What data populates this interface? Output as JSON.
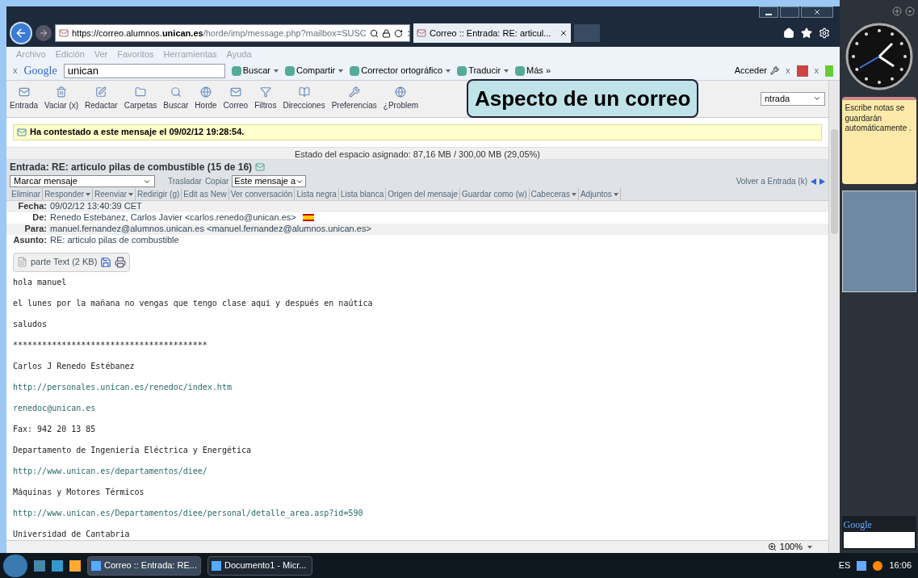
{
  "browser": {
    "address": {
      "prefix": "https://correo.alumnos.",
      "domain": "unican.es",
      "rest": "/horde/imp/message.php?mailbox=SUSC"
    },
    "tab": {
      "title": "Correo :: Entrada: RE: articul...",
      "selected": true
    },
    "menu": [
      "Archivo",
      "Edición",
      "Ver",
      "Favoritos",
      "Herramientas",
      "Ayuda"
    ],
    "google_toolbar": {
      "close": "x",
      "logo": "Google",
      "query": "unican",
      "items": [
        {
          "label": "Buscar",
          "menu": true
        },
        {
          "label": "Compartir",
          "menu": true
        },
        {
          "label": "Corrector ortográfico",
          "menu": true
        },
        {
          "label": "Traducir",
          "menu": true
        },
        {
          "label": "Más »",
          "menu": false
        }
      ],
      "signin": "Acceder",
      "close_right": "x",
      "close_far": "x"
    }
  },
  "horde_toolbar": [
    "Entrada",
    "Vaciar (x)",
    "Redactar",
    "Carpetas",
    "Buscar",
    "Horde",
    "Correo",
    "Filtros",
    "Direcciones",
    "Preferencias",
    "¿Problem"
  ],
  "folder_select": "ntrada",
  "callout": "Aspecto de un correo",
  "notice": "Ha contestado a este mensaje el 09/02/12 19:28:54.",
  "quota": "Estado del espacio asignado: 87,16 MB / 300,00 MB (29,05%)",
  "message_title": "Entrada: RE: articulo pilas de combustible (15 de 16)",
  "actions": {
    "mark_select": "Marcar mensaje",
    "move": "Trasladar",
    "copy": "Copiar",
    "target_select": "Este mensaje a",
    "back": "Volver a Entrada (k)"
  },
  "links": [
    {
      "label": "Eliminar",
      "menu": false
    },
    {
      "label": "Responder",
      "menu": true
    },
    {
      "label": "Reenviar",
      "menu": true
    },
    {
      "label": "Redirigir (g)",
      "menu": false
    },
    {
      "label": "Edit as New",
      "menu": false
    },
    {
      "label": "Ver conversación",
      "menu": false
    },
    {
      "label": "Lista negra",
      "menu": false
    },
    {
      "label": "Lista blanca",
      "menu": false
    },
    {
      "label": "Origen del mensaje",
      "menu": false
    },
    {
      "label": "Guardar como (w)",
      "menu": false
    },
    {
      "label": "Cabeceras",
      "menu": true
    },
    {
      "label": "Adjuntos",
      "menu": true
    }
  ],
  "headers": [
    {
      "label": "Fecha:",
      "value": "09/02/12 13:40:39 CET",
      "flag": false
    },
    {
      "label": "De:",
      "value": "Renedo Estebanez, Carlos Javier <carlos.renedo@unican.es>",
      "flag": true
    },
    {
      "label": "Para:",
      "value": "manuel.fernandez@alumnos.unican.es <manuel.fernandez@alumnos.unican.es>",
      "flag": false
    },
    {
      "label": "Asunto:",
      "value": "RE: articulo pilas de combustible",
      "flag": false
    }
  ],
  "part": "parte Text (2 KB)",
  "body": [
    {
      "kind": "text",
      "text": "hola manuel"
    },
    {
      "kind": "text",
      "text": "el lunes por la mañana no vengas que tengo clase aqui y después en naútica"
    },
    {
      "kind": "text",
      "text": "saludos"
    },
    {
      "kind": "text",
      "text": "****************************************"
    },
    {
      "kind": "text",
      "text": "Carlos J Renedo Estébanez"
    },
    {
      "kind": "link",
      "text": "http://personales.unican.es/renedoc/index.htm"
    },
    {
      "kind": "link",
      "text": "renedoc@unican.es"
    },
    {
      "kind": "text",
      "text": "Fax: 942 20 13 85"
    },
    {
      "kind": "text",
      "text": "Departamento de Ingeniería Eléctrica y Energética"
    },
    {
      "kind": "link",
      "text": "http://www.unican.es/departamentos/diee/"
    },
    {
      "kind": "text",
      "text": "Máquinas y Motores Térmicos"
    },
    {
      "kind": "link",
      "text": "http://www.unican.es/Departamentos/diee/personal/detalle_area.asp?id=590"
    },
    {
      "kind": "text",
      "text": "Universidad de Cantabria"
    }
  ],
  "zoom": "100%",
  "sidebar": {
    "note": "Escribe notas se guardarán automáticamente .",
    "google": "Google"
  },
  "taskbar": {
    "items": [
      {
        "label": "Correo :: Entrada: RE...",
        "selected": true
      },
      {
        "label": "Documento1 - Micr...",
        "selected": false
      }
    ],
    "language": "ES",
    "time": "16:06"
  }
}
